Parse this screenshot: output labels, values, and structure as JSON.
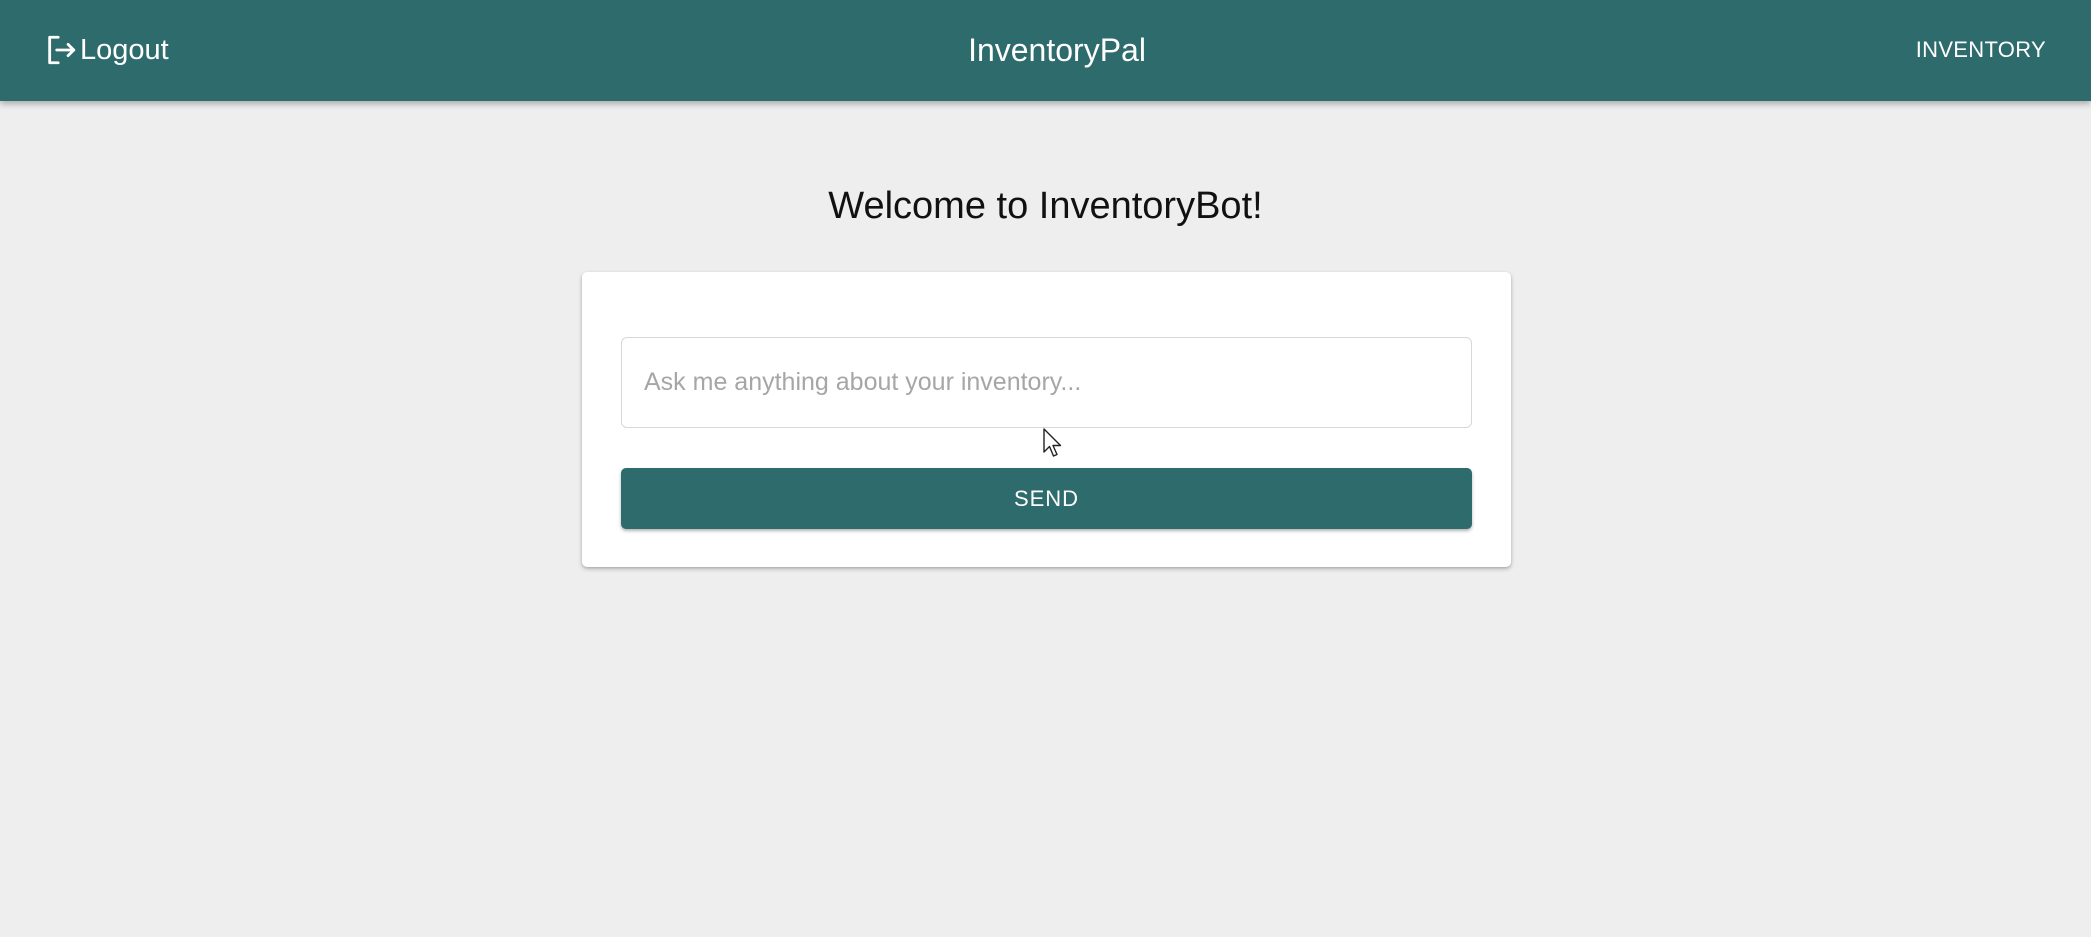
{
  "header": {
    "logout_label": "Logout",
    "logout_icon": "logout-icon",
    "app_title": "InventoryPal",
    "nav_inventory_label": "INVENTORY"
  },
  "main": {
    "welcome_text": "Welcome to InventoryBot!",
    "query": {
      "placeholder": "Ask me anything about your inventory...",
      "value": ""
    },
    "send_label": "SEND"
  },
  "colors": {
    "primary": "#2e6b6c",
    "background": "#eeeeee",
    "card": "#ffffff"
  }
}
